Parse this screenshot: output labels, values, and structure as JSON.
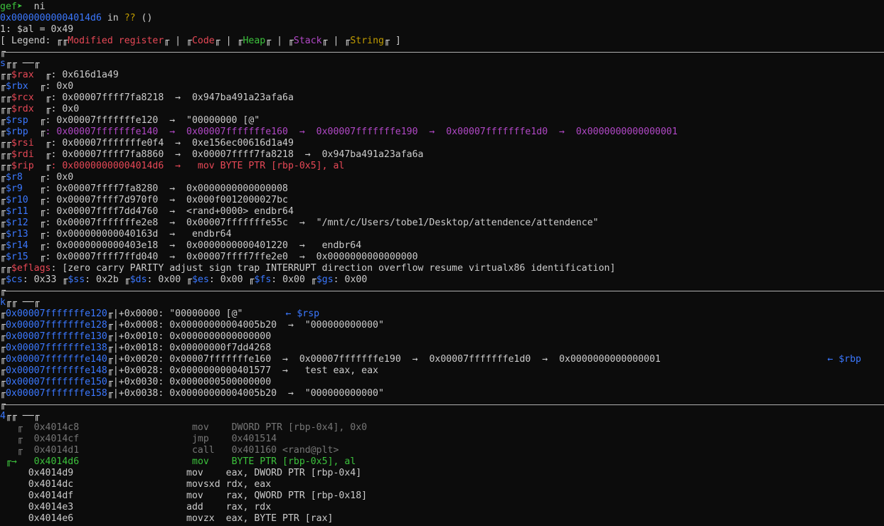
{
  "prompt": {
    "name": "gef➤",
    "command": "ni"
  },
  "location": {
    "address": "0x00000000004014d6",
    "in_text": " in ",
    "func": "??",
    "args": " ()"
  },
  "display": "1: $al = 0x49",
  "legend": {
    "prefix": "[ Legend: ",
    "items": [
      "Modified register",
      "Code",
      "Heap",
      "Stack",
      "String"
    ],
    "suffix": " ]"
  },
  "glyph": "╓",
  "registers": {
    "label": "s",
    "rows": [
      {
        "name": "$rax",
        "mod": true,
        "text": ": 0x616d1a49"
      },
      {
        "name": "$rbx",
        "mod": false,
        "text": ": 0x0"
      },
      {
        "name": "$rcx",
        "mod": true,
        "text": ": 0x00007ffff7fa8218  →  0x947ba491a23afa6a"
      },
      {
        "name": "$rdx",
        "mod": true,
        "text": ": 0x0"
      },
      {
        "name": "$rsp",
        "mod": false,
        "text": ": 0x00007fffffffe120  →  \"00000000 [@\""
      },
      {
        "name": "$rbp",
        "mod": false,
        "text": ": 0x00007fffffffe140  →  0x00007fffffffe160  →  0x00007fffffffe190  →  0x00007fffffffe1d0  →  0x0000000000000001"
      },
      {
        "name": "$rsi",
        "mod": true,
        "text": ": 0x00007fffffffe0f4  →  0xe156ec00616d1a49"
      },
      {
        "name": "$rdi",
        "mod": true,
        "text": ": 0x00007ffff7fa8860  →  0x00007ffff7fa8218  →  0x947ba491a23afa6a"
      },
      {
        "name": "$rip",
        "mod": true,
        "text": ": 0x00000000004014d6  →   mov BYTE PTR [rbp-0x5], al"
      },
      {
        "name": "$r8",
        "mod": false,
        "text": ": 0x0"
      },
      {
        "name": "$r9",
        "mod": false,
        "text": ": 0x00007ffff7fa8280  →  0x0000000000000008"
      },
      {
        "name": "$r10",
        "mod": false,
        "text": ": 0x00007ffff7d970f0  →  0x000f0012000027bc"
      },
      {
        "name": "$r11",
        "mod": false,
        "text": ": 0x00007ffff7dd4760  →  <rand+0000> endbr64"
      },
      {
        "name": "$r12",
        "mod": false,
        "text": ": 0x00007fffffffe2e8  →  0x00007fffffffe55c  →  \"/mnt/c/Users/tobe1/Desktop/attendence/attendence\""
      },
      {
        "name": "$r13",
        "mod": false,
        "text": ": 0x000000000040163d  →   endbr64"
      },
      {
        "name": "$r14",
        "mod": false,
        "text": ": 0x0000000000403e18  →  0x0000000000401220  →   endbr64"
      },
      {
        "name": "$r15",
        "mod": false,
        "text": ": 0x00007ffff7ffd040  →  0x00007ffff7ffe2e0  →  0x0000000000000000"
      }
    ],
    "eflags": {
      "name": "$eflags",
      "text": ": [zero carry PARITY adjust sign trap INTERRUPT direction overflow resume virtualx86 identification]"
    },
    "segments": [
      {
        "name": "$cs",
        "val": ": 0x33"
      },
      {
        "name": "$ss",
        "val": ": 0x2b"
      },
      {
        "name": "$ds",
        "val": ": 0x00"
      },
      {
        "name": "$es",
        "val": ": 0x00"
      },
      {
        "name": "$fs",
        "val": ": 0x00"
      },
      {
        "name": "$gs",
        "val": ": 0x00"
      }
    ]
  },
  "stack": {
    "label": "k",
    "rows": [
      {
        "addr": "0x00007fffffffe120",
        "off": "+0x0000: ",
        "val": "\"00000000 [@\"",
        "tag": "← $rsp"
      },
      {
        "addr": "0x00007fffffffe128",
        "off": "+0x0008: ",
        "val": "0x00000000004005b20  →  \"000000000000\"",
        "tag": ""
      },
      {
        "addr": "0x00007fffffffe130",
        "off": "+0x0010: ",
        "val": "0x0000000000000000",
        "tag": ""
      },
      {
        "addr": "0x00007fffffffe138",
        "off": "+0x0018: ",
        "val": "0x00000000f7dd4268",
        "tag": ""
      },
      {
        "addr": "0x00007fffffffe140",
        "off": "+0x0020: ",
        "val": "0x00007fffffffe160  →  0x00007fffffffe190  →  0x00007fffffffe1d0  →  0x0000000000000001",
        "tag": "← $rbp"
      },
      {
        "addr": "0x00007fffffffe148",
        "off": "+0x0028: ",
        "val": "0x0000000000401577  →   test eax, eax",
        "tag": ""
      },
      {
        "addr": "0x00007fffffffe150",
        "off": "+0x0030: ",
        "val": "0x0000000500000000",
        "tag": ""
      },
      {
        "addr": "0x00007fffffffe158",
        "off": "+0x0038: ",
        "val": "0x00000000004005b20  →  \"000000000000\"",
        "tag": ""
      }
    ]
  },
  "code": {
    "label": "4",
    "past": [
      {
        "addr": "0x4014c8",
        "mn": "mov",
        "ops": "DWORD PTR [rbp-0x4], 0x0"
      },
      {
        "addr": "0x4014cf",
        "mn": "jmp",
        "ops": "0x401514"
      },
      {
        "addr": "0x4014d1",
        "mn": "call",
        "ops": "0x401160 <rand@plt>"
      }
    ],
    "current": {
      "arrow": "→",
      "addr": "0x4014d6",
      "mn": "mov",
      "ops": "BYTE PTR [rbp-0x5], al"
    },
    "future": [
      {
        "addr": "0x4014d9",
        "mn": "mov",
        "ops": "eax, DWORD PTR [rbp-0x4]"
      },
      {
        "addr": "0x4014dc",
        "mn": "movsxd",
        "ops": "rdx, eax"
      },
      {
        "addr": "0x4014df",
        "mn": "mov",
        "ops": "rax, QWORD PTR [rbp-0x18]"
      },
      {
        "addr": "0x4014e3",
        "mn": "add",
        "ops": "rax, rdx"
      },
      {
        "addr": "0x4014e6",
        "mn": "movzx",
        "ops": "eax, BYTE PTR [rax]"
      }
    ]
  },
  "colors": {
    "background": "#0c0c0c",
    "text": "#cccccc",
    "green": "#3cc33c",
    "blue": "#3b78ff",
    "red": "#e74856",
    "purple": "#b148c6",
    "yellow": "#c19c00",
    "grey": "#767676"
  }
}
